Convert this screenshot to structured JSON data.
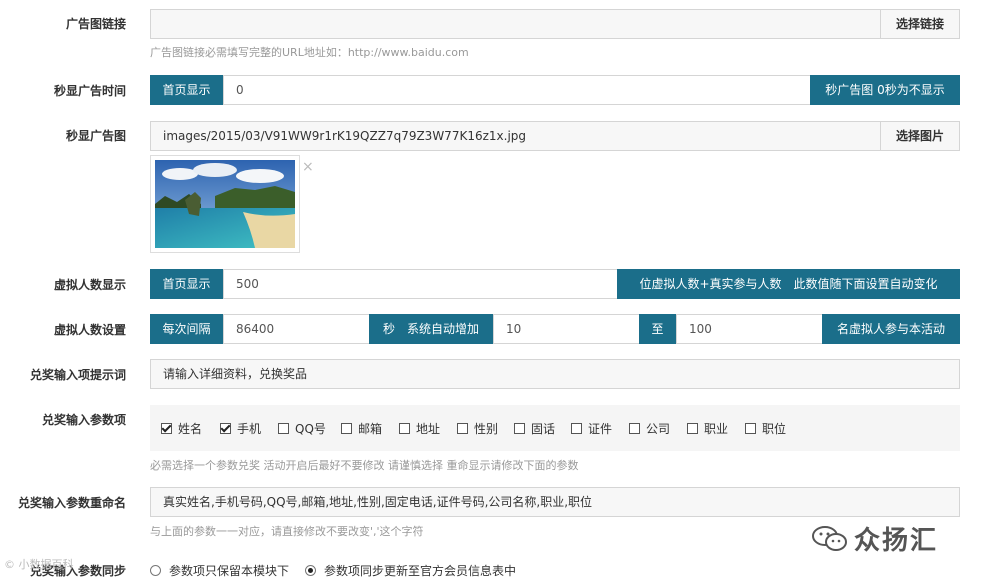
{
  "ad_link": {
    "label": "广告图链接",
    "value": "",
    "button": "选择链接",
    "help": "广告图链接必需填写完整的URL地址如：http://www.baidu.com"
  },
  "ad_time": {
    "label": "秒显广告时间",
    "prefix": "首页显示",
    "value": "0",
    "suffix": "秒广告图 0秒为不显示"
  },
  "ad_image": {
    "label": "秒显广告图",
    "value": "images/2015/03/V91WW9r1rK19QZZ7q79Z3W77K16z1x.jpg",
    "button": "选择图片",
    "delete_icon": "×"
  },
  "virtual_display": {
    "label": "虚拟人数显示",
    "prefix": "首页显示",
    "value": "500",
    "suffix": "位虚拟人数+真实参与人数　此数值随下面设置自动变化"
  },
  "virtual_settings": {
    "label": "虚拟人数设置",
    "prefix": "每次间隔",
    "interval": "86400",
    "mid": "秒　系统自动增加",
    "min": "10",
    "to": "至",
    "max": "100",
    "suffix": "名虚拟人参与本活动"
  },
  "prize_prompt": {
    "label": "兑奖输入项提示词",
    "value": "请输入详细资料，兑换奖品"
  },
  "prize_params": {
    "label": "兑奖输入参数项",
    "items": [
      {
        "label": "姓名",
        "checked": true
      },
      {
        "label": "手机",
        "checked": true
      },
      {
        "label": "QQ号",
        "checked": false
      },
      {
        "label": "邮箱",
        "checked": false
      },
      {
        "label": "地址",
        "checked": false
      },
      {
        "label": "性别",
        "checked": false
      },
      {
        "label": "固话",
        "checked": false
      },
      {
        "label": "证件",
        "checked": false
      },
      {
        "label": "公司",
        "checked": false
      },
      {
        "label": "职业",
        "checked": false
      },
      {
        "label": "职位",
        "checked": false
      }
    ],
    "help": "必需选择一个参数兑奖 活动开启后最好不要修改 请谨慎选择 重命显示请修改下面的参数"
  },
  "param_rename": {
    "label": "兑奖输入参数重命名",
    "value": "真实姓名,手机号码,QQ号,邮箱,地址,性别,固定电话,证件号码,公司名称,职业,职位",
    "help": "与上面的参数一一对应，请直接修改不要改变','这个字符"
  },
  "param_sync": {
    "label": "兑奖输入参数同步",
    "options": [
      {
        "label": "参数项只保留本模块下",
        "selected": false
      },
      {
        "label": "参数项同步更新至官方会员信息表中",
        "selected": true
      }
    ]
  },
  "watermark": {
    "right_text": "众扬汇",
    "left_text": "© 小数据百科"
  },
  "colors": {
    "accent": "#1b6e8a"
  }
}
